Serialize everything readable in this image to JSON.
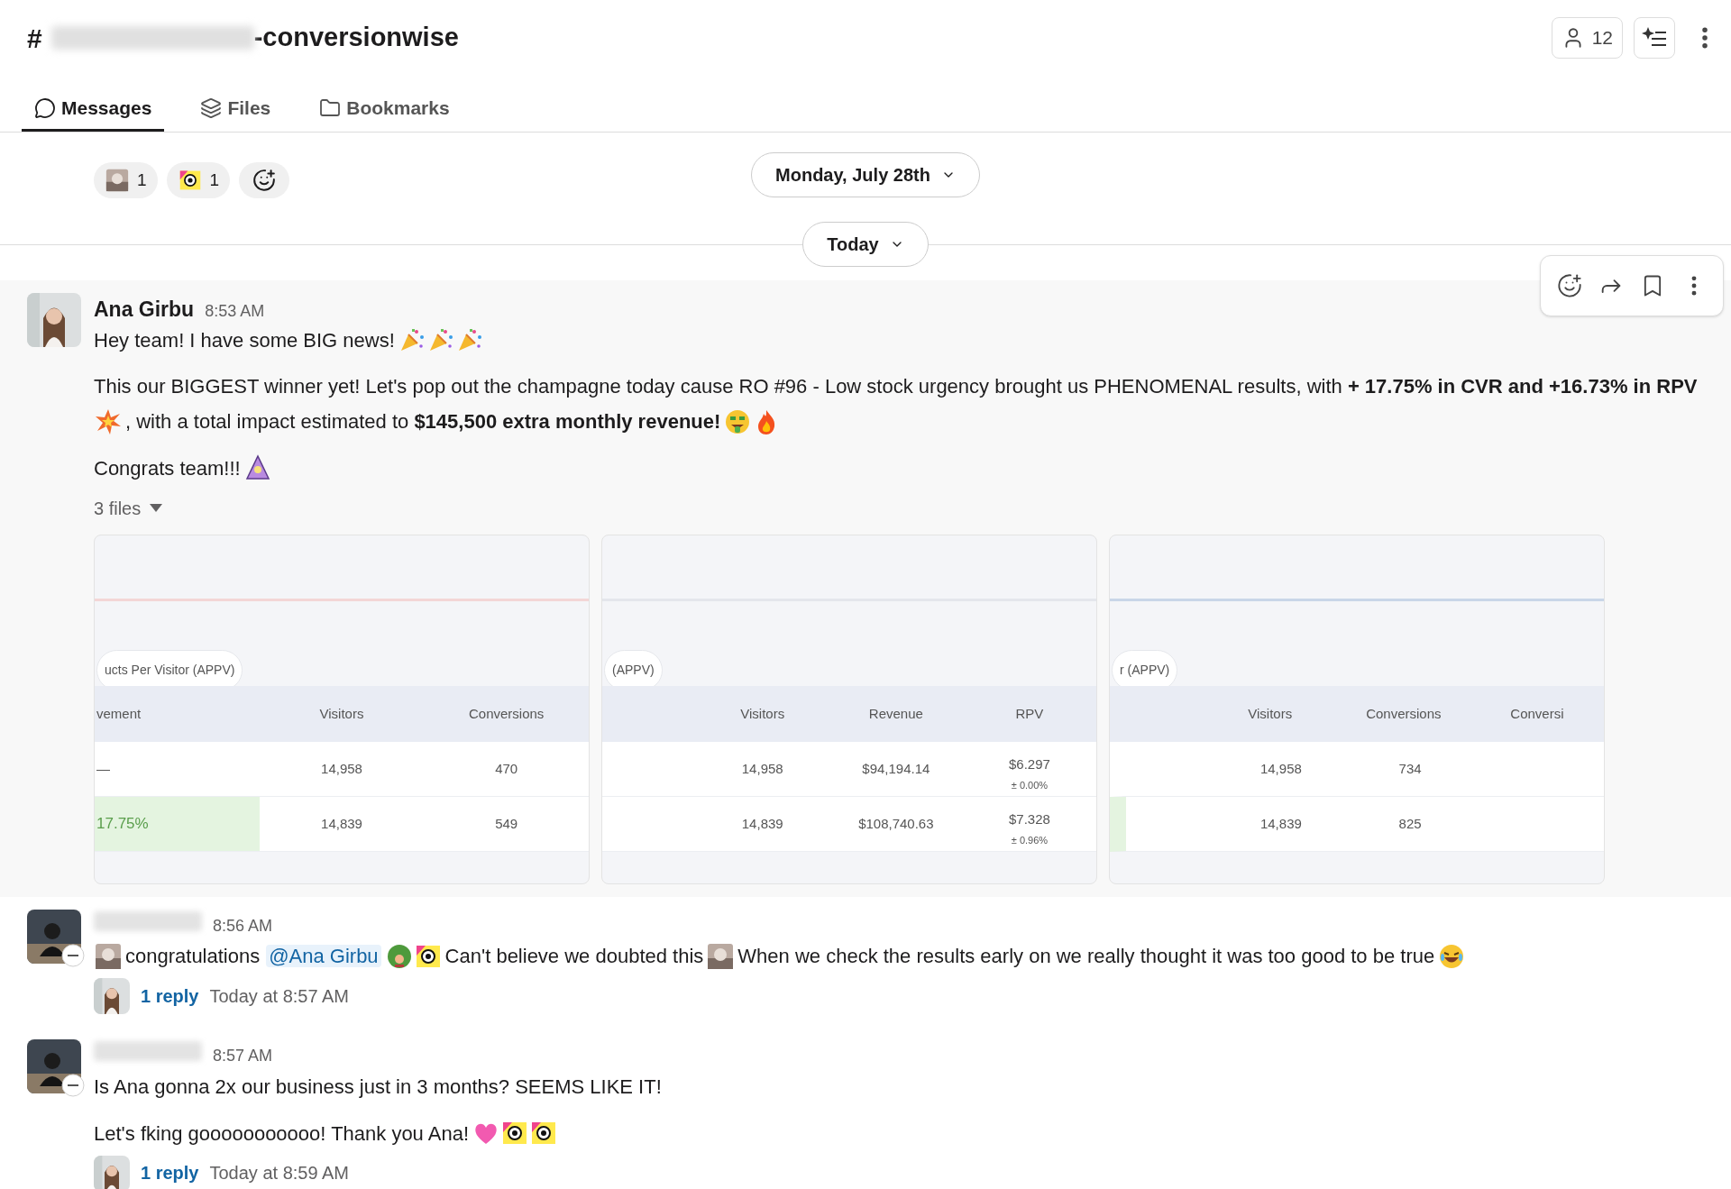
{
  "header": {
    "hash": "#",
    "title": "-conversionwise",
    "members_count": "12"
  },
  "tabs": [
    {
      "label": "Messages",
      "selected": true
    },
    {
      "label": "Files",
      "selected": false
    },
    {
      "label": "Bookmarks",
      "selected": false
    }
  ],
  "previous_reactions": [
    {
      "kind": "photo",
      "count": "1"
    },
    {
      "kind": "sticker",
      "count": "1"
    }
  ],
  "sticky_date": "Monday, July 28th",
  "day_divider": "Today",
  "messages": [
    {
      "author": "Ana Girbu",
      "time": "8:53 AM",
      "hovered": true,
      "paragraphs": [
        [
          {
            "kind": "text",
            "text": "Hey team! I have some BIG news!"
          },
          {
            "kind": "party"
          },
          {
            "kind": "party"
          },
          {
            "kind": "party"
          }
        ],
        [
          {
            "kind": "text",
            "text": "This our BIGGEST winner yet! Let's pop out the champagne today cause RO #96 - Low stock urgency brought us PHENOMENAL results, with **+ 17.75% in CVR and +16.73% in RPV**"
          },
          {
            "kind": "burst"
          },
          {
            "kind": "text",
            "text": ", with a total impact estimated to **$145,500 extra monthly revenue!**"
          },
          {
            "kind": "money"
          },
          {
            "kind": "fire"
          }
        ],
        [
          {
            "kind": "text",
            "text": "Congrats team!!!"
          },
          {
            "kind": "hat"
          }
        ]
      ],
      "files": {
        "label": "3 files",
        "cards": [
          {
            "color": "#f3d6d6",
            "pill": "ucts Per Visitor (APPV)",
            "columns": [
              "vement",
              "Visitors",
              "Conversions"
            ],
            "rows": [
              {
                "cells": [
                  {
                    "text": "—",
                    "highlight": false
                  },
                  {
                    "text": "14,958"
                  },
                  {
                    "text": "470"
                  }
                ]
              },
              {
                "cells": [
                  {
                    "text": "17.75%",
                    "highlight": true
                  },
                  {
                    "text": "14,839"
                  },
                  {
                    "text": "549"
                  }
                ]
              }
            ]
          },
          {
            "color": "#e4e6ec",
            "pill": "(APPV)",
            "columns": [
              "Visitors",
              "Revenue",
              "RPV"
            ],
            "rows": [
              {
                "cells": [
                  {
                    "text": "14,958"
                  },
                  {
                    "text": "$94,194.14"
                  },
                  {
                    "text": "$6.297",
                    "sub": "± 0.00%"
                  }
                ]
              },
              {
                "cells": [
                  {
                    "text": "14,839"
                  },
                  {
                    "text": "$108,740.63"
                  },
                  {
                    "text": "$7.328",
                    "sub": "± 0.96%"
                  }
                ]
              }
            ]
          },
          {
            "color": "#c9d6e8",
            "pill": "r (APPV)",
            "columns": [
              "Visitors",
              "Conversions",
              "Conversi"
            ],
            "rows": [
              {
                "lead_highlight": false,
                "cells": [
                  {
                    "text": "14,958"
                  },
                  {
                    "text": "734"
                  }
                ]
              },
              {
                "lead_highlight": true,
                "cells": [
                  {
                    "text": "14,839"
                  },
                  {
                    "text": "825"
                  }
                ]
              }
            ]
          }
        ]
      }
    },
    {
      "time": "8:56 AM",
      "hovered": false,
      "paragraphs": [
        [
          {
            "kind": "photo"
          },
          {
            "kind": "text",
            "text": "congratulations"
          },
          {
            "kind": "mention",
            "text": "@Ana Girbu"
          },
          {
            "kind": "plant"
          },
          {
            "kind": "sticker"
          },
          {
            "kind": "text",
            "text": "Can't believe we doubted this"
          },
          {
            "kind": "photo"
          },
          {
            "kind": "text",
            "text": "When we check the results early on we really thought it was too good to be true"
          },
          {
            "kind": "laugh"
          }
        ]
      ],
      "thread": {
        "replies": "1 reply",
        "last": "Today at 8:57 AM"
      }
    },
    {
      "time": "8:57 AM",
      "hovered": false,
      "paragraphs": [
        [
          {
            "kind": "text",
            "text": "Is Ana gonna 2x our business just in 3 months? SEEMS LIKE IT!"
          }
        ],
        [
          {
            "kind": "text",
            "text": "Let's fking gooooooooooo! Thank you Ana!"
          },
          {
            "kind": "heart"
          },
          {
            "kind": "sticker"
          },
          {
            "kind": "sticker"
          }
        ]
      ],
      "thread": {
        "replies": "1 reply",
        "last": "Today at 8:59 AM"
      }
    }
  ]
}
